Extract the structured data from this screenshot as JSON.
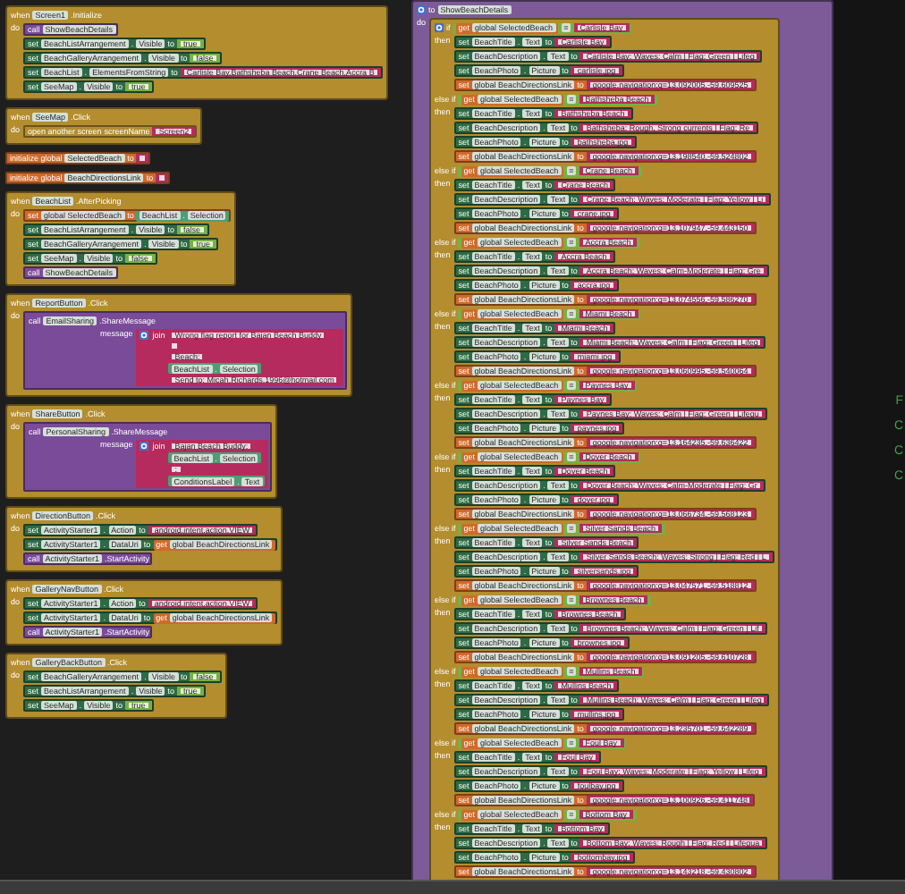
{
  "left_blocks": [
    {
      "kind": "event",
      "words": [
        "when",
        "Screen1",
        ".Initialize"
      ],
      "do": "do",
      "rows": [
        {
          "kind": "call",
          "words": [
            "call",
            "ShowBeachDetails"
          ]
        },
        {
          "kind": "set",
          "words": [
            "set",
            "BeachListArrangement",
            ".",
            "Visible",
            "to"
          ],
          "value": {
            "kind": "logic",
            "text": "true"
          }
        },
        {
          "kind": "set",
          "words": [
            "set",
            "BeachGalleryArrangement",
            ".",
            "Visible",
            "to"
          ],
          "value": {
            "kind": "logic",
            "text": "false"
          }
        },
        {
          "kind": "set",
          "words": [
            "set",
            "BeachList",
            ".",
            "ElementsFromString",
            "to"
          ],
          "value": {
            "kind": "text",
            "text": "Carlisle Bay,Bathsheba Beach,Crane Beach,Accra B"
          }
        },
        {
          "kind": "set",
          "words": [
            "set",
            "SeeMap",
            ".",
            "Visible",
            "to"
          ],
          "value": {
            "kind": "logic",
            "text": "true"
          }
        }
      ]
    },
    {
      "kind": "event",
      "words": [
        "when",
        "SeeMap",
        ".Click"
      ],
      "do": "do",
      "rows": [
        {
          "kind": "open",
          "words": [
            "open another screen",
            "screenName"
          ],
          "value": {
            "kind": "text",
            "text": "Screen2"
          }
        }
      ]
    },
    {
      "kind": "init",
      "words": [
        "initialize global",
        "SelectedBeach",
        "to"
      ],
      "value": {
        "kind": "text"
      }
    },
    {
      "kind": "init",
      "words": [
        "initialize global",
        "BeachDirectionsLink",
        "to"
      ],
      "value": {
        "kind": "text"
      }
    },
    {
      "kind": "event",
      "words": [
        "when",
        "BeachList",
        ".AfterPicking"
      ],
      "do": "do",
      "rows": [
        {
          "kind": "setglobal",
          "words": [
            "set",
            "global SelectedBeach",
            "to"
          ],
          "value": {
            "kind": "prop",
            "words": [
              "BeachList",
              ".",
              "Selection"
            ]
          }
        },
        {
          "kind": "set",
          "words": [
            "set",
            "BeachListArrangement",
            ".",
            "Visible",
            "to"
          ],
          "value": {
            "kind": "logic",
            "text": "false"
          }
        },
        {
          "kind": "set",
          "words": [
            "set",
            "BeachGalleryArrangement",
            ".",
            "Visible",
            "to"
          ],
          "value": {
            "kind": "logic",
            "text": "true"
          }
        },
        {
          "kind": "set",
          "words": [
            "set",
            "SeeMap",
            ".",
            "Visible",
            "to"
          ],
          "value": {
            "kind": "logic",
            "text": "false"
          }
        },
        {
          "kind": "call",
          "words": [
            "call",
            "ShowBeachDetails"
          ]
        }
      ]
    },
    {
      "kind": "event",
      "words": [
        "when",
        "ReportButton",
        ".Click"
      ],
      "do": "do",
      "rows": [
        {
          "kind": "method",
          "words": [
            "call",
            "EmailSharing",
            ".ShareMessage"
          ],
          "arg": "message",
          "value": {
            "kind": "join",
            "word": "join",
            "items": [
              {
                "kind": "text",
                "text": "Wrong flag report for Bajan Beach Buddy"
              },
              {
                "kind": "text"
              },
              {
                "kind": "text",
                "text": "Beach:"
              },
              {
                "kind": "prop",
                "words": [
                  "BeachList",
                  ".",
                  "Selection"
                ]
              },
              {
                "kind": "text",
                "text": "Send to: Micah.Richards.1996@hotmail.com"
              }
            ]
          }
        }
      ]
    },
    {
      "kind": "event",
      "words": [
        "when",
        "ShareButton",
        ".Click"
      ],
      "do": "do",
      "rows": [
        {
          "kind": "method",
          "words": [
            "call",
            "PersonalSharing",
            ".ShareMessage"
          ],
          "arg": "message",
          "value": {
            "kind": "join",
            "word": "join",
            "items": [
              {
                "kind": "text",
                "text": "Bajan Beach Buddy:"
              },
              {
                "kind": "prop",
                "words": [
                  "BeachList",
                  ".",
                  "Selection"
                ]
              },
              {
                "kind": "text",
                "text": ":"
              },
              {
                "kind": "prop",
                "words": [
                  "ConditionsLabel",
                  ".",
                  "Text"
                ]
              }
            ]
          }
        }
      ]
    },
    {
      "kind": "event",
      "words": [
        "when",
        "DirectionButton",
        ".Click"
      ],
      "do": "do",
      "rows": [
        {
          "kind": "set",
          "words": [
            "set",
            "ActivityStarter1",
            ".",
            "Action",
            "to"
          ],
          "value": {
            "kind": "text",
            "text": "android.intent.action.VIEW"
          }
        },
        {
          "kind": "set",
          "words": [
            "set",
            "ActivityStarter1",
            ".",
            "DataUri",
            "to"
          ],
          "value": {
            "kind": "get",
            "words": [
              "get",
              "global BeachDirectionsLink"
            ]
          }
        },
        {
          "kind": "method",
          "words": [
            "call",
            "ActivityStarter1",
            ".StartActivity"
          ]
        }
      ]
    },
    {
      "kind": "event",
      "words": [
        "when",
        "GalleryNavButton",
        ".Click"
      ],
      "do": "do",
      "rows": [
        {
          "kind": "set",
          "words": [
            "set",
            "ActivityStarter1",
            ".",
            "Action",
            "to"
          ],
          "value": {
            "kind": "text",
            "text": "android.intent.action.VIEW"
          }
        },
        {
          "kind": "set",
          "words": [
            "set",
            "ActivityStarter1",
            ".",
            "DataUri",
            "to"
          ],
          "value": {
            "kind": "get",
            "words": [
              "get",
              "global BeachDirectionsLink"
            ]
          }
        },
        {
          "kind": "method",
          "words": [
            "call",
            "ActivityStarter1",
            ".StartActivity"
          ]
        }
      ]
    },
    {
      "kind": "event",
      "words": [
        "when",
        "GalleryBackButton",
        ".Click"
      ],
      "do": "do",
      "rows": [
        {
          "kind": "set",
          "words": [
            "set",
            "BeachGalleryArrangement",
            ".",
            "Visible",
            "to"
          ],
          "value": {
            "kind": "logic",
            "text": "false"
          }
        },
        {
          "kind": "set",
          "words": [
            "set",
            "BeachListArrangement",
            ".",
            "Visible",
            "to"
          ],
          "value": {
            "kind": "logic",
            "text": "true"
          }
        },
        {
          "kind": "set",
          "words": [
            "set",
            "SeeMap",
            ".",
            "Visible",
            "to"
          ],
          "value": {
            "kind": "logic",
            "text": "true"
          }
        }
      ]
    }
  ],
  "procedure": {
    "words": [
      "to",
      "ShowBeachDetails"
    ],
    "do": "do",
    "branches": [
      {
        "word": "if",
        "then": "then",
        "test": {
          "kind": "compare",
          "left": {
            "kind": "get",
            "words": [
              "get",
              "global SelectedBeach"
            ]
          },
          "op": "=",
          "right": {
            "kind": "text",
            "text": "Carlisle Bay"
          }
        },
        "rows": [
          {
            "kind": "set",
            "words": [
              "set",
              "BeachTitle",
              ".",
              "Text",
              "to"
            ],
            "value": {
              "kind": "text",
              "text": "Carlisle Bay"
            }
          },
          {
            "kind": "set",
            "words": [
              "set",
              "BeachDescription",
              ".",
              "Text",
              "to"
            ],
            "value": {
              "kind": "text",
              "text": "Carlisle Bay: Waves: Calm | Flag: Green | Lifeg"
            }
          },
          {
            "kind": "set",
            "words": [
              "set",
              "BeachPhoto",
              ".",
              "Picture",
              "to"
            ],
            "value": {
              "kind": "text",
              "text": "carlisle.jpg"
            }
          },
          {
            "kind": "setglobal",
            "words": [
              "set",
              "global BeachDirectionsLink",
              "to"
            ],
            "value": {
              "kind": "text",
              "text": "google.navigation:q=13.092005,-59.609525"
            }
          }
        ]
      },
      {
        "word": "else if",
        "then": "then",
        "test": {
          "kind": "compare",
          "left": {
            "kind": "get",
            "words": [
              "get",
              "global SelectedBeach"
            ]
          },
          "op": "=",
          "right": {
            "kind": "text",
            "text": "Bathsheba Beach"
          }
        },
        "rows": [
          {
            "kind": "set",
            "words": [
              "set",
              "BeachTitle",
              ".",
              "Text",
              "to"
            ],
            "value": {
              "kind": "text",
              "text": "Bathsheba Beach"
            }
          },
          {
            "kind": "set",
            "words": [
              "set",
              "BeachDescription",
              ".",
              "Text",
              "to"
            ],
            "value": {
              "kind": "text",
              "text": "Bathsheba: Rough, Strong currents | Flag: Re"
            }
          },
          {
            "kind": "set",
            "words": [
              "set",
              "BeachPhoto",
              ".",
              "Picture",
              "to"
            ],
            "value": {
              "kind": "text",
              "text": "bathsheba.jpg"
            }
          },
          {
            "kind": "setglobal",
            "words": [
              "set",
              "global BeachDirectionsLink",
              "to"
            ],
            "value": {
              "kind": "text",
              "text": "google.navigation:q=13.198540,-59.524802"
            }
          }
        ]
      },
      {
        "word": "else if",
        "then": "then",
        "test": {
          "kind": "compare",
          "left": {
            "kind": "get",
            "words": [
              "get",
              "global SelectedBeach"
            ]
          },
          "op": "=",
          "right": {
            "kind": "text",
            "text": "Crane Beach"
          }
        },
        "rows": [
          {
            "kind": "set",
            "words": [
              "set",
              "BeachTitle",
              ".",
              "Text",
              "to"
            ],
            "value": {
              "kind": "text",
              "text": "Crane Beach"
            }
          },
          {
            "kind": "set",
            "words": [
              "set",
              "BeachDescription",
              ".",
              "Text",
              "to"
            ],
            "value": {
              "kind": "text",
              "text": "Crane Beach: Waves: Moderate | Flag: Yellow | Li"
            }
          },
          {
            "kind": "set",
            "words": [
              "set",
              "BeachPhoto",
              ".",
              "Picture",
              "to"
            ],
            "value": {
              "kind": "text",
              "text": "crane.jpg"
            }
          },
          {
            "kind": "setglobal",
            "words": [
              "set",
              "global BeachDirectionsLink",
              "to"
            ],
            "value": {
              "kind": "text",
              "text": "google.navigation:q=13.107947,-59.443150"
            }
          }
        ]
      },
      {
        "word": "else if",
        "then": "then",
        "test": {
          "kind": "compare",
          "left": {
            "kind": "get",
            "words": [
              "get",
              "global SelectedBeach"
            ]
          },
          "op": "=",
          "right": {
            "kind": "text",
            "text": "Accra Beach"
          }
        },
        "rows": [
          {
            "kind": "set",
            "words": [
              "set",
              "BeachTitle",
              ".",
              "Text",
              "to"
            ],
            "value": {
              "kind": "text",
              "text": "Accra Beach"
            }
          },
          {
            "kind": "set",
            "words": [
              "set",
              "BeachDescription",
              ".",
              "Text",
              "to"
            ],
            "value": {
              "kind": "text",
              "text": "Accra Beach: Waves: Calm-Moderate | Flag: Gre"
            }
          },
          {
            "kind": "set",
            "words": [
              "set",
              "BeachPhoto",
              ".",
              "Picture",
              "to"
            ],
            "value": {
              "kind": "text",
              "text": "accra.jpg"
            }
          },
          {
            "kind": "setglobal",
            "words": [
              "set",
              "global BeachDirectionsLink",
              "to"
            ],
            "value": {
              "kind": "text",
              "text": "google.navigation:q=13.074556,-59.586270"
            }
          }
        ]
      },
      {
        "word": "else if",
        "then": "then",
        "test": {
          "kind": "compare",
          "left": {
            "kind": "get",
            "words": [
              "get",
              "global SelectedBeach"
            ]
          },
          "op": "=",
          "right": {
            "kind": "text",
            "text": "Miami Beach"
          }
        },
        "rows": [
          {
            "kind": "set",
            "words": [
              "set",
              "BeachTitle",
              ".",
              "Text",
              "to"
            ],
            "value": {
              "kind": "text",
              "text": "Miami Beach"
            }
          },
          {
            "kind": "set",
            "words": [
              "set",
              "BeachDescription",
              ".",
              "Text",
              "to"
            ],
            "value": {
              "kind": "text",
              "text": "Miami Beach: Waves: Calm | Flag: Green | Lifeg"
            }
          },
          {
            "kind": "set",
            "words": [
              "set",
              "BeachPhoto",
              ".",
              "Picture",
              "to"
            ],
            "value": {
              "kind": "text",
              "text": "miami.jpg"
            }
          },
          {
            "kind": "setglobal",
            "words": [
              "set",
              "global BeachDirectionsLink",
              "to"
            ],
            "value": {
              "kind": "text",
              "text": "google.navigation:q=13.060995,-59.540064"
            }
          }
        ]
      },
      {
        "word": "else if",
        "then": "then",
        "test": {
          "kind": "compare",
          "left": {
            "kind": "get",
            "words": [
              "get",
              "global SelectedBeach"
            ]
          },
          "op": "=",
          "right": {
            "kind": "text",
            "text": "Paynes Bay"
          }
        },
        "rows": [
          {
            "kind": "set",
            "words": [
              "set",
              "BeachTitle",
              ".",
              "Text",
              "to"
            ],
            "value": {
              "kind": "text",
              "text": "Paynes Bay"
            }
          },
          {
            "kind": "set",
            "words": [
              "set",
              "BeachDescription",
              ".",
              "Text",
              "to"
            ],
            "value": {
              "kind": "text",
              "text": "Paynes Bay: Waves: Calm | Flag: Green | Lifegu"
            }
          },
          {
            "kind": "set",
            "words": [
              "set",
              "BeachPhoto",
              ".",
              "Picture",
              "to"
            ],
            "value": {
              "kind": "text",
              "text": "paynes.jpg"
            }
          },
          {
            "kind": "setglobal",
            "words": [
              "set",
              "global BeachDirectionsLink",
              "to"
            ],
            "value": {
              "kind": "text",
              "text": "google.navigation:q=13.164235,-59.636422"
            }
          }
        ]
      },
      {
        "word": "else if",
        "then": "then",
        "test": {
          "kind": "compare",
          "left": {
            "kind": "get",
            "words": [
              "get",
              "global SelectedBeach"
            ]
          },
          "op": "=",
          "right": {
            "kind": "text",
            "text": "Dover Beach"
          }
        },
        "rows": [
          {
            "kind": "set",
            "words": [
              "set",
              "BeachTitle",
              ".",
              "Text",
              "to"
            ],
            "value": {
              "kind": "text",
              "text": "Dover Beach"
            }
          },
          {
            "kind": "set",
            "words": [
              "set",
              "BeachDescription",
              ".",
              "Text",
              "to"
            ],
            "value": {
              "kind": "text",
              "text": "Dover Beach: Waves: Calm-Moderate | Flag: Gr"
            }
          },
          {
            "kind": "set",
            "words": [
              "set",
              "BeachPhoto",
              ".",
              "Picture",
              "to"
            ],
            "value": {
              "kind": "text",
              "text": "dover.jpg"
            }
          },
          {
            "kind": "setglobal",
            "words": [
              "set",
              "global BeachDirectionsLink",
              "to"
            ],
            "value": {
              "kind": "text",
              "text": "google.navigation:q=13.066734,-59.568123"
            }
          }
        ]
      },
      {
        "word": "else if",
        "then": "then",
        "test": {
          "kind": "compare",
          "left": {
            "kind": "get",
            "words": [
              "get",
              "global SelectedBeach"
            ]
          },
          "op": "=",
          "right": {
            "kind": "text",
            "text": "Silver Sands Beach"
          }
        },
        "rows": [
          {
            "kind": "set",
            "words": [
              "set",
              "BeachTitle",
              ".",
              "Text",
              "to"
            ],
            "value": {
              "kind": "text",
              "text": "Silver Sands Beach"
            }
          },
          {
            "kind": "set",
            "words": [
              "set",
              "BeachDescription",
              ".",
              "Text",
              "to"
            ],
            "value": {
              "kind": "text",
              "text": "Silver Sands Beach: Waves: Strong | Flag: Red | L"
            }
          },
          {
            "kind": "set",
            "words": [
              "set",
              "BeachPhoto",
              ".",
              "Picture",
              "to"
            ],
            "value": {
              "kind": "text",
              "text": "silversands.jpg"
            }
          },
          {
            "kind": "setglobal",
            "words": [
              "set",
              "global BeachDirectionsLink",
              "to"
            ],
            "value": {
              "kind": "text",
              "text": "google.navigation:q=13.047571,-59.518812"
            }
          }
        ]
      },
      {
        "word": "else if",
        "then": "then",
        "test": {
          "kind": "compare",
          "left": {
            "kind": "get",
            "words": [
              "get",
              "global SelectedBeach"
            ]
          },
          "op": "=",
          "right": {
            "kind": "text",
            "text": "Brownes Beach"
          }
        },
        "rows": [
          {
            "kind": "set",
            "words": [
              "set",
              "BeachTitle",
              ".",
              "Text",
              "to"
            ],
            "value": {
              "kind": "text",
              "text": "Brownes Beach"
            }
          },
          {
            "kind": "set",
            "words": [
              "set",
              "BeachDescription",
              ".",
              "Text",
              "to"
            ],
            "value": {
              "kind": "text",
              "text": "Brownes Beach: Waves: Calm | Flag: Green | Lif"
            }
          },
          {
            "kind": "set",
            "words": [
              "set",
              "BeachPhoto",
              ".",
              "Picture",
              "to"
            ],
            "value": {
              "kind": "text",
              "text": "brownes.jpg"
            }
          },
          {
            "kind": "setglobal",
            "words": [
              "set",
              "global BeachDirectionsLink",
              "to"
            ],
            "value": {
              "kind": "text",
              "text": "google.navigation:q=13.091205,-59.610728"
            }
          }
        ]
      },
      {
        "word": "else if",
        "then": "then",
        "test": {
          "kind": "compare",
          "left": {
            "kind": "get",
            "words": [
              "get",
              "global SelectedBeach"
            ]
          },
          "op": "=",
          "right": {
            "kind": "text",
            "text": "Mullins Beach"
          }
        },
        "rows": [
          {
            "kind": "set",
            "words": [
              "set",
              "BeachTitle",
              ".",
              "Text",
              "to"
            ],
            "value": {
              "kind": "text",
              "text": "Mullins Beach"
            }
          },
          {
            "kind": "set",
            "words": [
              "set",
              "BeachDescription",
              ".",
              "Text",
              "to"
            ],
            "value": {
              "kind": "text",
              "text": "Mullins Beach: Waves: Calm | Flag: Green | Lifeg"
            }
          },
          {
            "kind": "set",
            "words": [
              "set",
              "BeachPhoto",
              ".",
              "Picture",
              "to"
            ],
            "value": {
              "kind": "text",
              "text": "mullins.jpg"
            }
          },
          {
            "kind": "setglobal",
            "words": [
              "set",
              "global BeachDirectionsLink",
              "to"
            ],
            "value": {
              "kind": "text",
              "text": "google.navigation:q=13.235701,-59.642289"
            }
          }
        ]
      },
      {
        "word": "else if",
        "then": "then",
        "test": {
          "kind": "compare",
          "left": {
            "kind": "get",
            "words": [
              "get",
              "global SelectedBeach"
            ]
          },
          "op": "=",
          "right": {
            "kind": "text",
            "text": "Foul Bay"
          }
        },
        "rows": [
          {
            "kind": "set",
            "words": [
              "set",
              "BeachTitle",
              ".",
              "Text",
              "to"
            ],
            "value": {
              "kind": "text",
              "text": "Foul Bay"
            }
          },
          {
            "kind": "set",
            "words": [
              "set",
              "BeachDescription",
              ".",
              "Text",
              "to"
            ],
            "value": {
              "kind": "text",
              "text": "Foul Bay: Waves: Moderate | Flag: Yellow | Lifeg"
            }
          },
          {
            "kind": "set",
            "words": [
              "set",
              "BeachPhoto",
              ".",
              "Picture",
              "to"
            ],
            "value": {
              "kind": "text",
              "text": "foulbay.jpg"
            }
          },
          {
            "kind": "setglobal",
            "words": [
              "set",
              "global BeachDirectionsLink",
              "to"
            ],
            "value": {
              "kind": "text",
              "text": "google.navigation:q=13.100926,-59.411748"
            }
          }
        ]
      },
      {
        "word": "else if",
        "then": "then",
        "test": {
          "kind": "compare",
          "left": {
            "kind": "get",
            "words": [
              "get",
              "global SelectedBeach"
            ]
          },
          "op": "=",
          "right": {
            "kind": "text",
            "text": "Bottom Bay"
          }
        },
        "rows": [
          {
            "kind": "set",
            "words": [
              "set",
              "BeachTitle",
              ".",
              "Text",
              "to"
            ],
            "value": {
              "kind": "text",
              "text": "Bottom Bay"
            }
          },
          {
            "kind": "set",
            "words": [
              "set",
              "BeachDescription",
              ".",
              "Text",
              "to"
            ],
            "value": {
              "kind": "text",
              "text": "Bottom Bay: Waves: Rough | Flag: Red | Lifegua"
            }
          },
          {
            "kind": "set",
            "words": [
              "set",
              "BeachPhoto",
              ".",
              "Picture",
              "to"
            ],
            "value": {
              "kind": "text",
              "text": "bottombay.jpg"
            }
          },
          {
            "kind": "setglobal",
            "words": [
              "set",
              "global BeachDirectionsLink",
              "to"
            ],
            "value": {
              "kind": "text",
              "text": "google.navigation:q=13.143218,-59.430802"
            }
          }
        ]
      }
    ]
  },
  "edge_labels": [
    "F",
    "C",
    "C",
    "C"
  ]
}
